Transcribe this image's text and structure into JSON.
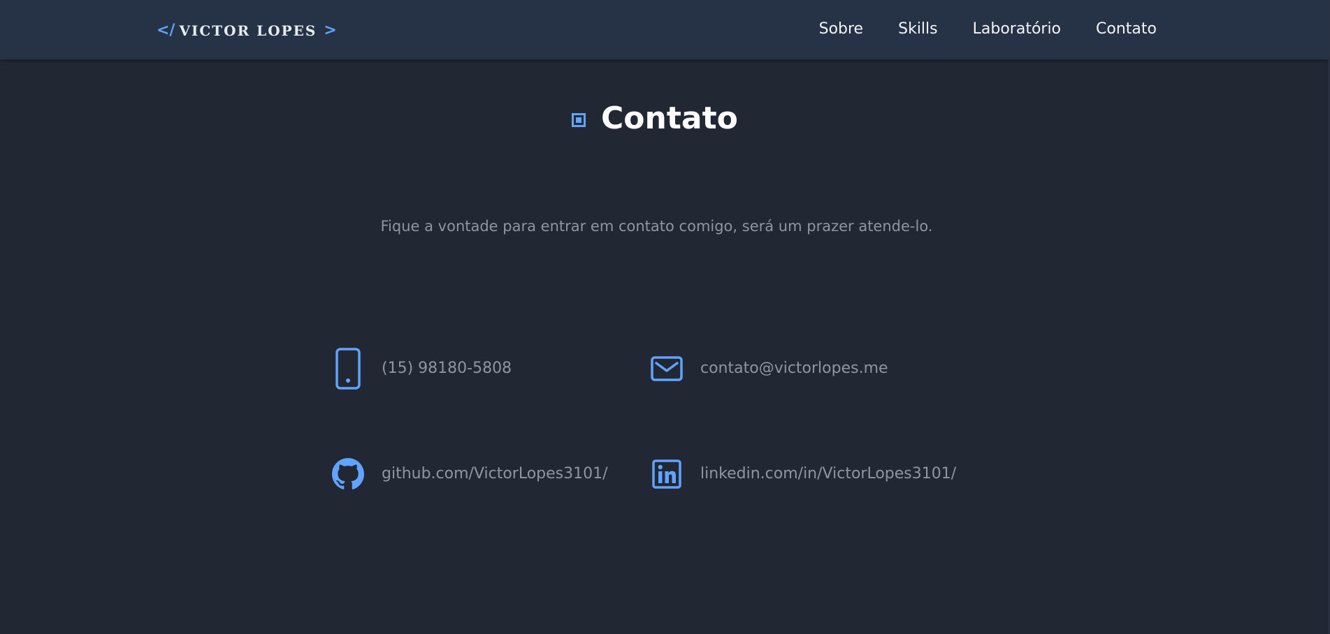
{
  "header": {
    "logo": {
      "open_bracket": "</",
      "name": "VICTOR LOPES",
      "close_bracket": ">"
    },
    "nav": [
      {
        "label": "Sobre"
      },
      {
        "label": "Skills"
      },
      {
        "label": "Laboratório"
      },
      {
        "label": "Contato"
      }
    ]
  },
  "section": {
    "icon": "square-target-icon",
    "title": "Contato",
    "subtitle": "Fique a vontade para entrar em contato comigo, será um prazer atende-lo."
  },
  "contacts": [
    {
      "icon": "phone-icon",
      "text": "(15) 98180-5808"
    },
    {
      "icon": "mail-icon",
      "text": "contato@victorlopes.me"
    },
    {
      "icon": "github-icon",
      "text": "github.com/VictorLopes3101/"
    },
    {
      "icon": "linkedin-icon",
      "text": "linkedin.com/in/VictorLopes3101/"
    }
  ],
  "colors": {
    "background": "#212733",
    "navbar": "#263246",
    "accent": "#61a3ff",
    "text_muted": "#8e96a3",
    "text_light": "#f3f5f8"
  }
}
